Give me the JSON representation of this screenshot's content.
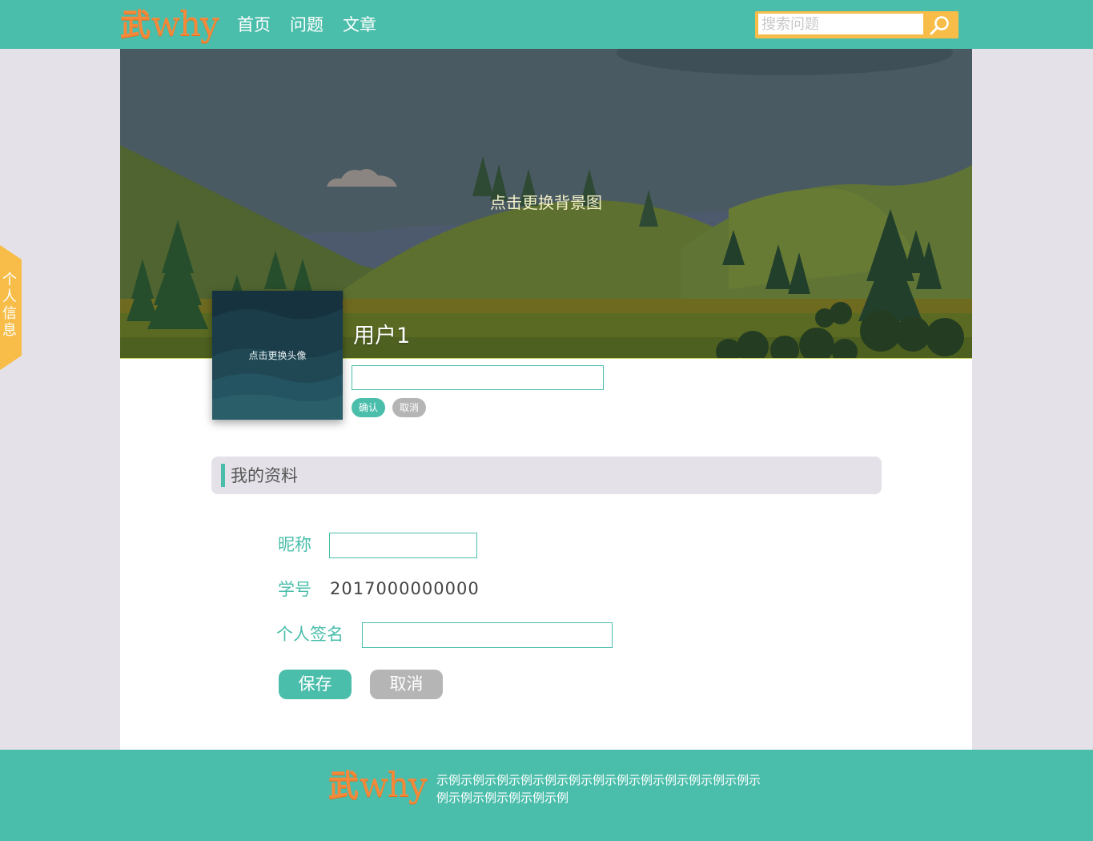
{
  "brand": {
    "logo_cn": "武",
    "logo_en": "why"
  },
  "nav": {
    "items": [
      "首页",
      "问题",
      "文章"
    ]
  },
  "search": {
    "placeholder": "搜索问题"
  },
  "banner": {
    "change_bg_text": "点击更换背景图"
  },
  "profile": {
    "avatar_text": "点击更换头像",
    "username": "用户1",
    "confirm_label": "确认",
    "cancel_label": "取消"
  },
  "section": {
    "title": "我的资料"
  },
  "form": {
    "nickname_label": "昵称",
    "student_id_label": "学号",
    "student_id_value": "2017000000000",
    "signature_label": "个人签名",
    "save_label": "保存",
    "cancel_label": "取消"
  },
  "sidetab": {
    "label": "个人信息"
  },
  "footer": {
    "description": "示例示例示例示例示例示例示例示例示例示例示例示例示例示例示例示例示例示例示例"
  },
  "colors": {
    "primary": "#4bbeab",
    "accent": "#f7bd48",
    "logo": "#f5893a",
    "muted_button": "#b5b5b5",
    "page_bg": "#e4e2e8"
  },
  "icons": {
    "search": "search-icon"
  }
}
